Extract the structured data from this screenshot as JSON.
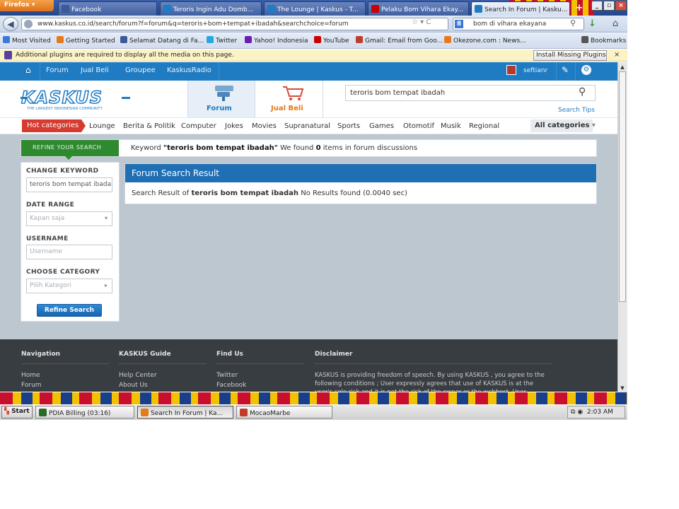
{
  "browser": {
    "menu_label": "Firefox",
    "tabs": [
      {
        "label": "Facebook",
        "color": "#3b5998",
        "active": false
      },
      {
        "label": "Teroris Ingin Adu Domb...",
        "color": "#1f7bc2",
        "active": false
      },
      {
        "label": "The Lounge | Kaskus - T...",
        "color": "#1f7bc2",
        "active": false
      },
      {
        "label": "Pelaku Bom Vihara Ekay...",
        "color": "#cc0000",
        "active": false
      },
      {
        "label": "Search In Forum | Kasku...",
        "color": "#1f7bc2",
        "active": true
      }
    ],
    "new_tab": "+",
    "url": "www.kaskus.co.id/search/forum?f=forum&q=teroris+bom+tempat+ibadah&searchchoice=forum",
    "search_engine_label": "8",
    "search_value": "bom di vihara ekayana",
    "window_buttons": {
      "minimize": "_",
      "maximize": "▫",
      "close": "×"
    }
  },
  "bookmarks": [
    {
      "label": "Most Visited",
      "color": "#3d78d8"
    },
    {
      "label": "Getting Started",
      "color": "#e57a1b"
    },
    {
      "label": "Selamat Datang di Fa...",
      "color": "#3b5998"
    },
    {
      "label": "Twitter",
      "color": "#29a8e0"
    },
    {
      "label": "Yahoo! Indonesia",
      "color": "#6d1bb0"
    },
    {
      "label": "YouTube",
      "color": "#cc0000"
    },
    {
      "label": "Gmail: Email from Goo...",
      "color": "#c33b2b"
    },
    {
      "label": "Okezone.com : News...",
      "color": "#e57a1b"
    },
    {
      "label": "Bookmarks",
      "color": "#555555"
    }
  ],
  "plugin_bar": {
    "message": "Additional plugins are required to display all the media on this page.",
    "button": "Install Missing Plugins...",
    "close": "×"
  },
  "kaskus_nav": {
    "items": [
      "Forum",
      "Jual Beli",
      "Groupee",
      "KaskusRadio"
    ],
    "username": "seftianr"
  },
  "header": {
    "logo": "KASKUS",
    "tagline": "THE LARGEST INDONESIAN COMMUNITY",
    "forum_label": "Forum",
    "jualbeli_label": "Jual Beli",
    "search_value": "teroris bom tempat ibadah",
    "search_tips": "Search Tips"
  },
  "categories": {
    "hot": "Hot categories",
    "items": [
      "Lounge",
      "Berita & Politik",
      "Computer",
      "Jokes",
      "Movies",
      "Supranatural",
      "Sports",
      "Games",
      "Otomotif",
      "Musik",
      "Regional"
    ],
    "all": "All categories"
  },
  "refine": {
    "tag": "REFINE YOUR SEARCH",
    "prefix": "Keyword ",
    "keyword": "\"teroris bom tempat ibadah\"",
    "mid": " We found ",
    "count": "0",
    "suffix": " items in forum discussions"
  },
  "sidebar": {
    "change_keyword_label": "CHANGE KEYWORD",
    "keyword_value": "teroris bom tempat ibadah",
    "date_range_label": "DATE RANGE",
    "date_range_value": "Kapan saja",
    "username_label": "USERNAME",
    "username_placeholder": "Username",
    "category_label": "CHOOSE CATEGORY",
    "category_value": "Pilih Kategori",
    "submit": "Refine Search"
  },
  "results": {
    "title": "Forum Search Result",
    "prefix": "Search Result of ",
    "query": "teroris bom tempat ibadah",
    "status": " No Results found (0.0040 sec)"
  },
  "footer": {
    "navigation": {
      "title": "Navigation",
      "links": [
        "Home",
        "Forum"
      ]
    },
    "guide": {
      "title": "KASKUS Guide",
      "links": [
        "Help Center",
        "About Us"
      ]
    },
    "find_us": {
      "title": "Find Us",
      "links": [
        "Twitter",
        "Facebook"
      ]
    },
    "disclaimer": {
      "title": "Disclaimer",
      "text": "KASKUS is providing freedom of speech. By using KASKUS , you agree to the following conditions ; User expressly agrees that use of KASKUS is at the user's sole risk and it is not the risk of the owner or the webhost. User"
    }
  },
  "taskbar": {
    "start": "Start",
    "buttons": [
      {
        "label": "PDIA Billing (03:16)",
        "color": "#2a6a2a",
        "active": false
      },
      {
        "label": "Search In Forum | Ka...",
        "color": "#e57a1b",
        "active": true
      },
      {
        "label": "MocaoMarbe",
        "color": "#c33b2b",
        "active": false
      }
    ],
    "clock": "2:03 AM"
  }
}
